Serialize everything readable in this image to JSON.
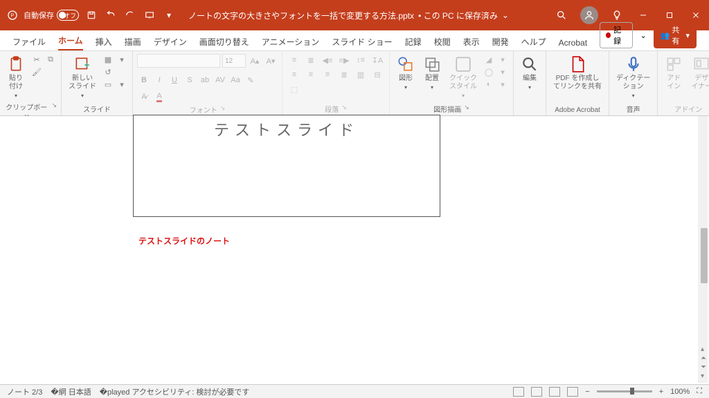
{
  "titlebar": {
    "autosave_label": "自動保存",
    "autosave_state": "オフ",
    "filename": "ノートの文字の大きさやフォントを一括で変更する方法.pptx",
    "saved_status": "• この PC に保存済み"
  },
  "tabs": {
    "file": "ファイル",
    "home": "ホーム",
    "insert": "挿入",
    "draw": "描画",
    "design": "デザイン",
    "transitions": "画面切り替え",
    "animations": "アニメーション",
    "slideshow": "スライド ショー",
    "record": "記録",
    "review": "校閲",
    "view": "表示",
    "developer": "開発",
    "help": "ヘルプ",
    "acrobat": "Acrobat",
    "rec_btn": "記録",
    "share_btn": "共有"
  },
  "ribbon": {
    "clipboard": {
      "paste": "貼り付け",
      "label": "クリップボード"
    },
    "slides": {
      "new_slide": "新しい\nスライド",
      "label": "スライド"
    },
    "font": {
      "size": "12",
      "label": "フォント"
    },
    "paragraph": {
      "label": "段落"
    },
    "drawing": {
      "shapes": "図形",
      "arrange": "配置",
      "quick": "クイック\nスタイル",
      "label": "図形描画"
    },
    "editing": {
      "label": "編集"
    },
    "acrobat": {
      "pdf": "PDF を作成し\nてリンクを共有",
      "label": "Adobe Acrobat"
    },
    "voice": {
      "dictate": "ディクテー\nション",
      "label": "音声"
    },
    "addins": {
      "addin": "アド\nイン",
      "designer": "デザ\nイナー",
      "label": "アドイン"
    }
  },
  "slide": {
    "title": "テストスライド",
    "note": "テストスライドのノート"
  },
  "status": {
    "page": "ノート 2/3",
    "lang": "日本語",
    "a11y": "アクセシビリティ: 検討が必要です",
    "zoom": "100%"
  }
}
